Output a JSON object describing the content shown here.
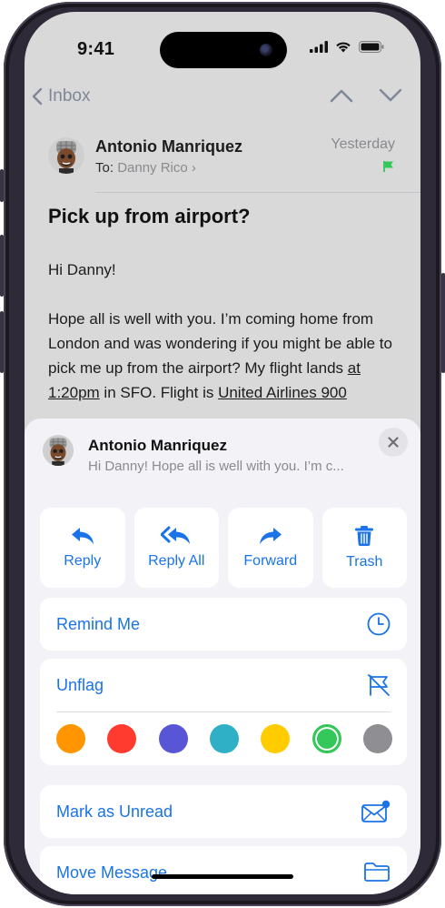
{
  "status_bar": {
    "time": "9:41"
  },
  "nav": {
    "back_label": "Inbox"
  },
  "message": {
    "sender": "Antonio Manriquez",
    "to_prefix": "To:",
    "recipient": "Danny Rico",
    "recipient_chevron": "›",
    "date": "Yesterday",
    "subject": "Pick up from airport?",
    "greeting": "Hi Danny!",
    "body_part1": "Hope all is well with you. I’m coming home from London and was wondering if you might be able to pick me up from the airport? My flight lands ",
    "body_time_link": "at 1:20pm",
    "body_part2": " in SFO. Flight is ",
    "body_flight_link": "United Airlines 900"
  },
  "sheet": {
    "sender": "Antonio Manriquez",
    "preview": "Hi Danny! Hope all is well with you. I’m c...",
    "actions": [
      {
        "label": "Reply",
        "icon": "reply-icon"
      },
      {
        "label": "Reply All",
        "icon": "reply-all-icon"
      },
      {
        "label": "Forward",
        "icon": "forward-icon"
      },
      {
        "label": "Trash",
        "icon": "trash-icon"
      }
    ],
    "remind_me": "Remind Me",
    "unflag": "Unflag",
    "flag_colors": [
      "#ff9500",
      "#ff3b30",
      "#5856d6",
      "#30b0c7",
      "#ffcc00",
      "#34c759",
      "#8e8e93"
    ],
    "selected_color": "#34c759",
    "mark_unread": "Mark as Unread",
    "move_message": "Move Message"
  },
  "colors": {
    "accent": "#1a73e8",
    "flag_green": "#34c759",
    "frame": "#2f2a38"
  }
}
